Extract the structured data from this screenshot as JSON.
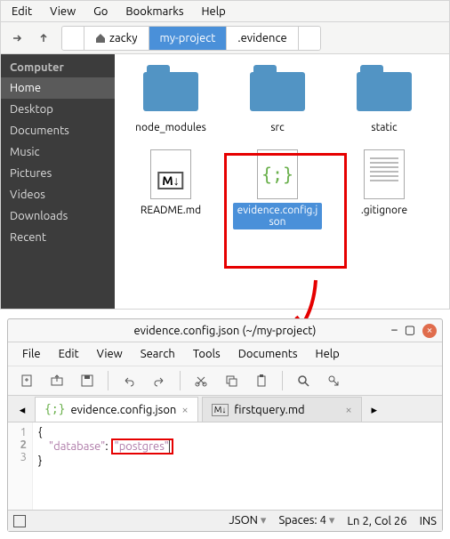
{
  "fm": {
    "menu": [
      "Edit",
      "View",
      "Go",
      "Bookmarks",
      "Help"
    ],
    "crumbs": {
      "home": "zacky",
      "active": "my-project",
      "next": ".evidence"
    },
    "sidebar": {
      "header": "Computer",
      "items": [
        "Home",
        "Desktop",
        "Documents",
        "Music",
        "Pictures",
        "Videos",
        "Downloads",
        "Recent"
      ]
    },
    "files": {
      "f0": "node_modules",
      "f1": "src",
      "f2": "static",
      "f3": "README.md",
      "f4": "evidence.config.json",
      "f5": ".gitignore"
    }
  },
  "ed": {
    "title": "evidence.config.json (~/my-project)",
    "menu": [
      "File",
      "Edit",
      "View",
      "Search",
      "Tools",
      "Documents",
      "Help"
    ],
    "tabs": {
      "t0": "evidence.config.json",
      "t1": "firstquery.md"
    },
    "code": {
      "l1": "{",
      "key": "\"database\"",
      "colon": ": ",
      "val": "\"postgres\"",
      "l3": "}"
    },
    "status": {
      "lang": "JSON",
      "spaces": "Spaces: 4",
      "pos": "Ln 2, Col 26",
      "ins": "INS"
    }
  }
}
